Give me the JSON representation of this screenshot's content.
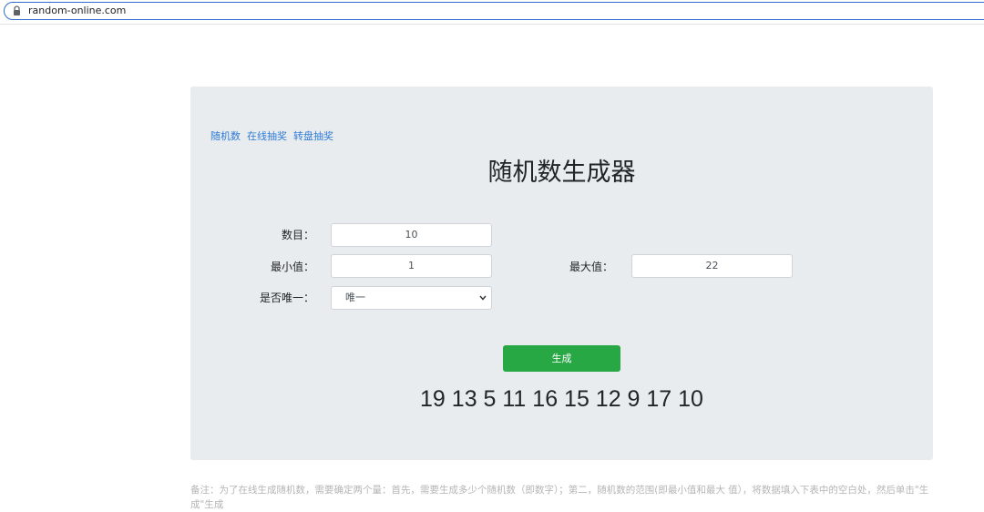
{
  "browser": {
    "url": "random-online.com",
    "icon": "lock-icon"
  },
  "nav": {
    "items": [
      "随机数",
      "在线抽奖",
      "转盘抽奖"
    ]
  },
  "title": "随机数生成器",
  "form": {
    "count_label": "数目：",
    "count_value": "10",
    "min_label": "最小值：",
    "min_value": "1",
    "max_label": "最大值：",
    "max_value": "22",
    "unique_label": "是否唯一：",
    "unique_value": "唯一"
  },
  "generate_button": "生成",
  "result": "19 13 5 11 16 15 12 9 17 10",
  "note": "备注：为了在线生成随机数，需要确定两个量：首先，需要生成多少个随机数（即数字）；第二，随机数的范围(即最小值和最大 值），将数据填入下表中的空白处，然后单击\"生成\"生成"
}
